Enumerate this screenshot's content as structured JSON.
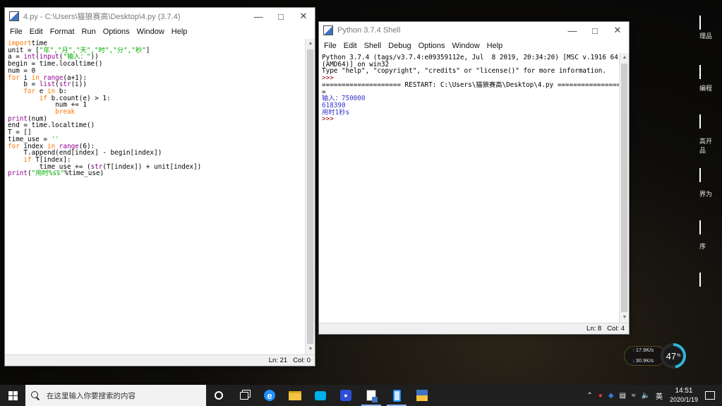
{
  "editor": {
    "title": "4.py - C:\\Users\\猫狼赛高\\Desktop\\4.py (3.7.4)",
    "menu": [
      "File",
      "Edit",
      "Format",
      "Run",
      "Options",
      "Window",
      "Help"
    ],
    "code": [
      [
        [
          "kw",
          "import"
        ],
        [
          "",
          "time"
        ]
      ],
      [
        [
          "",
          "unit = ["
        ],
        [
          "st",
          "\"年\",\"月\",\"天\",\"时\",\"分\",\"秒\""
        ],
        [
          "",
          "]"
        ]
      ],
      [
        [
          "",
          "a = "
        ],
        [
          "bi",
          "int"
        ],
        [
          "",
          "("
        ],
        [
          "bi",
          "input"
        ],
        [
          "",
          "("
        ],
        [
          "st",
          "\"输入：\""
        ],
        [
          "",
          "))"
        ]
      ],
      [
        [
          "",
          "begin = time.localtime()"
        ]
      ],
      [
        [
          "",
          "num = 0"
        ]
      ],
      [
        [
          "kw",
          "for"
        ],
        [
          "",
          " i "
        ],
        [
          "kw",
          "in"
        ],
        [
          "",
          ""
        ],
        [
          "bi",
          " range"
        ],
        [
          "",
          "(a+1):"
        ]
      ],
      [
        [
          "",
          "    b = "
        ],
        [
          "bi",
          "list"
        ],
        [
          "",
          "("
        ],
        [
          "bi",
          "str"
        ],
        [
          "",
          "(i))"
        ]
      ],
      [
        [
          "",
          "    "
        ],
        [
          "kw",
          "for"
        ],
        [
          "",
          " e "
        ],
        [
          "kw",
          "in"
        ],
        [
          "",
          " b:"
        ]
      ],
      [
        [
          "",
          "        "
        ],
        [
          "kw",
          "if"
        ],
        [
          "",
          " b.count(e) > 1:"
        ]
      ],
      [
        [
          "",
          "            num += 1"
        ]
      ],
      [
        [
          "",
          "            "
        ],
        [
          "kw",
          "break"
        ]
      ],
      [
        [
          "bi",
          "print"
        ],
        [
          "",
          "(num)"
        ]
      ],
      [
        [
          "",
          "end = time.localtime()"
        ]
      ],
      [
        [
          "",
          "T = []"
        ]
      ],
      [
        [
          "",
          "time_use = "
        ],
        [
          "st",
          "''"
        ]
      ],
      [
        [
          "kw",
          "for"
        ],
        [
          "",
          " index "
        ],
        [
          "kw",
          "in"
        ],
        [
          "",
          " "
        ],
        [
          "bi",
          "range"
        ],
        [
          "",
          "(6):"
        ]
      ],
      [
        [
          "",
          "    T.append(end[index] - begin[index])"
        ]
      ],
      [
        [
          "",
          "    "
        ],
        [
          "kw",
          "if"
        ],
        [
          "",
          " T[index]:"
        ]
      ],
      [
        [
          "",
          "        time_use += ("
        ],
        [
          "bi",
          "str"
        ],
        [
          "",
          "(T[index]) + unit[index])"
        ]
      ],
      [
        [
          "bi",
          "print"
        ],
        [
          "",
          "("
        ],
        [
          "st",
          "\"用时%ss\""
        ],
        [
          "",
          "%time_use)"
        ]
      ]
    ],
    "status": {
      "ln": "Ln: 21",
      "col": "Col: 0"
    }
  },
  "shell": {
    "title": "Python 3.7.4 Shell",
    "menu": [
      "File",
      "Edit",
      "Shell",
      "Debug",
      "Options",
      "Window",
      "Help"
    ],
    "lines": [
      [
        "",
        "Python 3.7.4 (tags/v3.7.4:e09359112e, Jul  8 2019, 20:34:20) [MSC v.1916 64 bit"
      ],
      [
        "",
        "(AMD64)] on win32"
      ],
      [
        "",
        "Type \"help\", \"copyright\", \"credits\" or \"license()\" for more information."
      ],
      [
        "prompt",
        ">>> "
      ],
      [
        "",
        "==================== RESTART: C:\\Users\\猫狼赛高\\Desktop\\4.py ===================="
      ],
      [
        "",
        "="
      ],
      [
        "out",
        "输入：750000"
      ],
      [
        "out",
        "618390"
      ],
      [
        "out",
        "用时1秒s"
      ],
      [
        "prompt",
        ">>> "
      ]
    ],
    "status": {
      "ln": "Ln: 8",
      "col": "Col: 4"
    }
  },
  "desktop": {
    "labels": [
      {
        "text": "理品"
      },
      {
        "text": "编程"
      },
      {
        "text": "高开"
      },
      {
        "text": "品"
      },
      {
        "text": "界为"
      },
      {
        "text": "序"
      }
    ]
  },
  "speed_widget": {
    "upload": "17.9K/s",
    "download": "30.9K/s",
    "percent": "47",
    "percent_unit": "%",
    "percent_value": 0.47
  },
  "taskbar": {
    "search_placeholder": "在这里输入你要搜索的内容",
    "time": "14:51",
    "date": "2020/1/19",
    "ime": "英"
  }
}
